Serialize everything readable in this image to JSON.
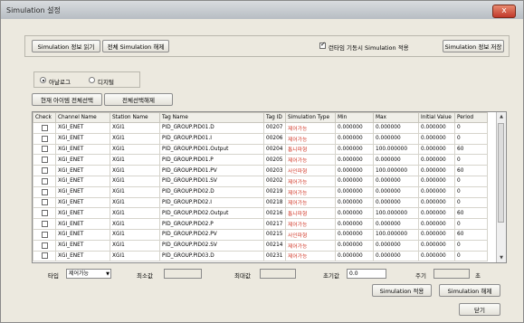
{
  "window": {
    "title": "Simulation 설정",
    "close_label": "x"
  },
  "toolbar": {
    "load_button": "Simulation 정보 읽기",
    "release_all_button": "전체 Simulation 해제",
    "runtime_checkbox_label": "런타임 기동시 Simulation 적용",
    "runtime_checked": true,
    "save_button": "Simulation 정보 저장"
  },
  "mode": {
    "analog_label": "아날로그",
    "digital_label": "디지털",
    "selected": "analog"
  },
  "selection": {
    "select_all_button": "현재 아이템 전체선택",
    "deselect_all_button": "전체선택해제"
  },
  "table": {
    "columns": [
      "Check",
      "Channel Name",
      "Station Name",
      "Tag Name",
      "Tag ID",
      "Simulation Type",
      "Min",
      "Max",
      "Initial Value",
      "Period"
    ],
    "rows": [
      {
        "channel": "XGI_ENET",
        "station": "XGI1",
        "tag": "PID_GROUP.PID01.D",
        "id": "00207",
        "type": "제어가능",
        "min": "0.000000",
        "max": "0.000000",
        "init": "0.000000",
        "period": "0"
      },
      {
        "channel": "XGI_ENET",
        "station": "XGI1",
        "tag": "PID_GROUP.PID01.I",
        "id": "00206",
        "type": "제어가능",
        "min": "0.000000",
        "max": "0.000000",
        "init": "0.000000",
        "period": "0"
      },
      {
        "channel": "XGI_ENET",
        "station": "XGI1",
        "tag": "PID_GROUP.PID01.Output",
        "id": "00204",
        "type": "톱니파형",
        "min": "0.000000",
        "max": "100.000000",
        "init": "0.000000",
        "period": "60"
      },
      {
        "channel": "XGI_ENET",
        "station": "XGI1",
        "tag": "PID_GROUP.PID01.P",
        "id": "00205",
        "type": "제어가능",
        "min": "0.000000",
        "max": "0.000000",
        "init": "0.000000",
        "period": "0"
      },
      {
        "channel": "XGI_ENET",
        "station": "XGI1",
        "tag": "PID_GROUP.PID01.PV",
        "id": "00203",
        "type": "사인파형",
        "min": "0.000000",
        "max": "100.000000",
        "init": "0.000000",
        "period": "60"
      },
      {
        "channel": "XGI_ENET",
        "station": "XGI1",
        "tag": "PID_GROUP.PID01.SV",
        "id": "00202",
        "type": "제어가능",
        "min": "0.000000",
        "max": "0.000000",
        "init": "0.000000",
        "period": "0"
      },
      {
        "channel": "XGI_ENET",
        "station": "XGI1",
        "tag": "PID_GROUP.PID02.D",
        "id": "00219",
        "type": "제어가능",
        "min": "0.000000",
        "max": "0.000000",
        "init": "0.000000",
        "period": "0"
      },
      {
        "channel": "XGI_ENET",
        "station": "XGI1",
        "tag": "PID_GROUP.PID02.I",
        "id": "00218",
        "type": "제어가능",
        "min": "0.000000",
        "max": "0.000000",
        "init": "0.000000",
        "period": "0"
      },
      {
        "channel": "XGI_ENET",
        "station": "XGI1",
        "tag": "PID_GROUP.PID02.Output",
        "id": "00216",
        "type": "톱니파형",
        "min": "0.000000",
        "max": "100.000000",
        "init": "0.000000",
        "period": "60"
      },
      {
        "channel": "XGI_ENET",
        "station": "XGI1",
        "tag": "PID_GROUP.PID02.P",
        "id": "00217",
        "type": "제어가능",
        "min": "0.000000",
        "max": "0.000000",
        "init": "0.000000",
        "period": "0"
      },
      {
        "channel": "XGI_ENET",
        "station": "XGI1",
        "tag": "PID_GROUP.PID02.PV",
        "id": "00215",
        "type": "사인파형",
        "min": "0.000000",
        "max": "100.000000",
        "init": "0.000000",
        "period": "60"
      },
      {
        "channel": "XGI_ENET",
        "station": "XGI1",
        "tag": "PID_GROUP.PID02.SV",
        "id": "00214",
        "type": "제어가능",
        "min": "0.000000",
        "max": "0.000000",
        "init": "0.000000",
        "period": "0"
      },
      {
        "channel": "XGI_ENET",
        "station": "XGI1",
        "tag": "PID_GROUP.PID03.D",
        "id": "00231",
        "type": "제어가능",
        "min": "0.000000",
        "max": "0.000000",
        "init": "0.000000",
        "period": "0"
      }
    ]
  },
  "bottom": {
    "type_label": "타입",
    "type_value": "제어가능",
    "min_label": "최소값",
    "min_value": "",
    "max_label": "최대값",
    "max_value": "",
    "init_label": "초기값",
    "init_value": "0.0",
    "period_label": "주기",
    "period_value": "",
    "period_unit": "초",
    "apply_button": "Simulation 적용",
    "release_button": "Simulation 해제",
    "close_button": "닫기"
  },
  "colors": {
    "sim_type_text": "#d23a2a",
    "dialog_bg": "#ece9df"
  },
  "icons": {
    "close": "close-icon",
    "scroll_up": "scroll-up-icon",
    "scroll_down": "scroll-down-icon",
    "dropdown": "chevron-down-icon"
  }
}
